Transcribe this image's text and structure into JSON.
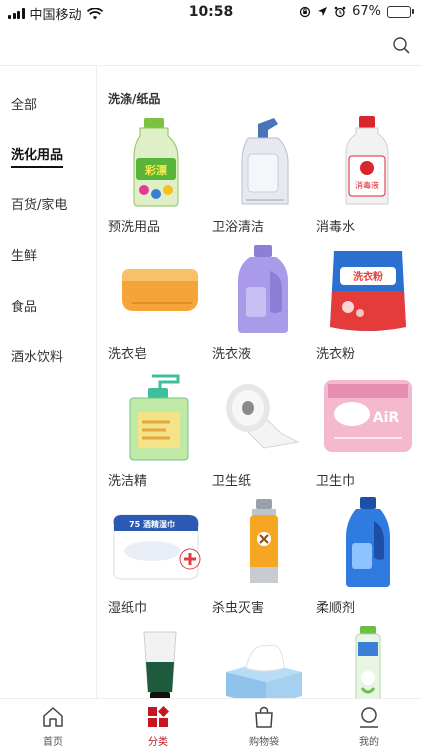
{
  "status_bar": {
    "carrier": "中国移动",
    "time": "10:58",
    "battery_percent": "67%",
    "battery_level": 0.67
  },
  "sidebar": {
    "items": [
      {
        "label": "全部",
        "active": false
      },
      {
        "label": "洗化用品",
        "active": true
      },
      {
        "label": "百货/家电",
        "active": false
      },
      {
        "label": "生鲜",
        "active": false
      },
      {
        "label": "食品",
        "active": false
      },
      {
        "label": "酒水饮料",
        "active": false
      }
    ]
  },
  "content": {
    "section_title": "洗涤/纸品",
    "products": [
      {
        "label": "预洗用品",
        "icon": "prewash-bottle-icon"
      },
      {
        "label": "卫浴清洁",
        "icon": "toilet-cleaner-icon"
      },
      {
        "label": "消毒水",
        "icon": "disinfectant-bottle-icon"
      },
      {
        "label": "洗衣皂",
        "icon": "laundry-soap-icon"
      },
      {
        "label": "洗衣液",
        "icon": "laundry-liquid-icon"
      },
      {
        "label": "洗衣粉",
        "icon": "laundry-powder-icon"
      },
      {
        "label": "洗洁精",
        "icon": "dish-soap-icon"
      },
      {
        "label": "卫生纸",
        "icon": "toilet-paper-icon"
      },
      {
        "label": "卫生巾",
        "icon": "sanitary-pad-icon"
      },
      {
        "label": "湿纸巾",
        "icon": "wet-wipes-icon"
      },
      {
        "label": "杀虫灭害",
        "icon": "insecticide-spray-icon"
      },
      {
        "label": "柔顺剂",
        "icon": "softener-bottle-icon"
      },
      {
        "label": "",
        "icon": "tube-icon"
      },
      {
        "label": "",
        "icon": "tissue-box-icon"
      },
      {
        "label": "",
        "icon": "air-freshener-icon"
      }
    ],
    "package_text": {
      "prewash": "彩漂",
      "disinfectant": "消毒液",
      "powder": "洗衣粉",
      "wipes": "75 酒精湿巾",
      "pad": "AiR"
    }
  },
  "tabbar": {
    "tabs": [
      {
        "label": "首页",
        "icon": "home-icon",
        "active": false
      },
      {
        "label": "分类",
        "icon": "category-grid-icon",
        "active": true
      },
      {
        "label": "购物袋",
        "icon": "shopping-bag-icon",
        "active": false
      },
      {
        "label": "我的",
        "icon": "profile-icon",
        "active": false
      }
    ]
  },
  "colors": {
    "accent": "#c4161c",
    "text": "#333333",
    "divider": "#eeeeee"
  }
}
